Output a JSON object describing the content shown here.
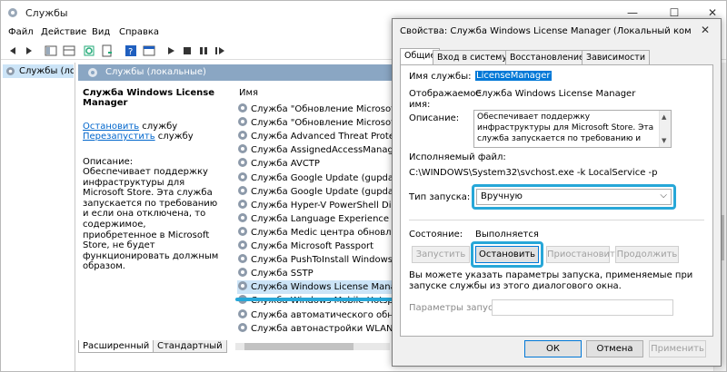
{
  "window": {
    "title": "Службы",
    "controls": [
      "—",
      "☐",
      "✕"
    ]
  },
  "menu": [
    "Файл",
    "Действие",
    "Вид",
    "Справка"
  ],
  "tree": {
    "selected": "Службы (лок"
  },
  "header": {
    "title": "Службы (локальные)"
  },
  "description": {
    "title": "Служба Windows License Manager",
    "stop_link": "Остановить",
    "stop_rest": " службу",
    "restart_link": "Перезапустить",
    "restart_rest": " службу",
    "label": "Описание:",
    "text": "Обеспечивает поддержку инфраструктуры для Microsoft Store. Эта служба запускается по требованию и если она отключена, то содержимое, приобретенное в Microsoft Store, не будет функционировать должным образом."
  },
  "list": {
    "column": "Имя",
    "items": [
      "Служба \"Обновление Microsoft Ed...",
      "Служба \"Обновление Microsoft Ed...",
      "Служба Advanced Threat Protection",
      "Служба AssignedAccessManager",
      "Служба AVCTP",
      "Служба Google Update (gupdate)",
      "Служба Google Update (gupdatem)",
      "Служба Hyper-V PowerShell Direct",
      "Служба Language Experience Service",
      "Служба Medic центра обновления...",
      "Служба Microsoft Passport",
      "Служба PushToInstall Windows",
      "Служба SSTP",
      "Служба Windows License Manager",
      "Служба Windows Mobile Hotspot",
      "Служба автоматического обнару...",
      "Служба автонастройки WLAN"
    ],
    "selected_index": 13
  },
  "bottom_tabs": [
    "Расширенный",
    "Стандартный"
  ],
  "dialog": {
    "title": "Свойства: Служба Windows License Manager (Локальный компь...",
    "close": "✕",
    "tabs": [
      "Общие",
      "Вход в систему",
      "Восстановление",
      "Зависимости"
    ],
    "service_name_label": "Имя службы:",
    "service_name": "LicenseManager",
    "display_name_label": "Отображаемое имя:",
    "display_name": "Служба Windows License Manager",
    "desc_label": "Описание:",
    "desc_text": "Обеспечивает поддержку инфраструктуры для Microsoft Store. Эта служба запускается по требованию и если она отключена, то содержимое, приобретенное в Microsoft Store,",
    "exec_label": "Исполняемый файл:",
    "exec_path": "C:\\WINDOWS\\System32\\svchost.exe -k LocalService -p",
    "startup_label": "Тип запуска:",
    "startup_value": "Вручную",
    "status_label": "Состояние:",
    "status_value": "Выполняется",
    "btn_start": "Запустить",
    "btn_stop": "Остановить",
    "btn_pause": "Приостановить",
    "btn_resume": "Продолжить",
    "hint": "Вы можете указать параметры запуска, применяемые при запуске службы из этого диалогового окна.",
    "params_label": "Параметры запуска:",
    "btn_ok": "ОК",
    "btn_cancel": "Отмена",
    "btn_apply": "Применить"
  },
  "colors": {
    "highlight": "#27a7d8",
    "selection": "#cce4f7",
    "link": "#0066cc"
  }
}
